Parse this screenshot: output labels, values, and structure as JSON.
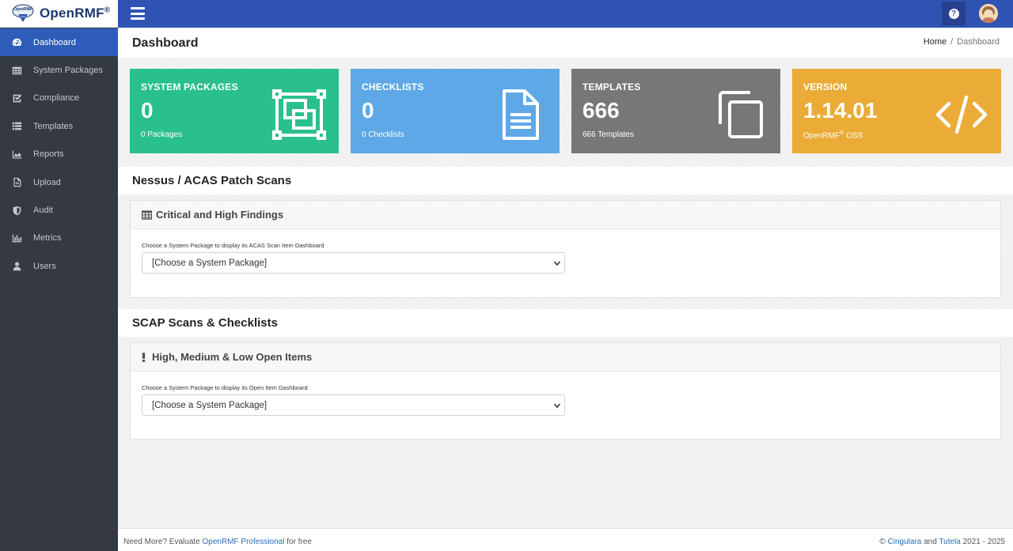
{
  "brand": {
    "name": "OpenRMF",
    "reg": "®"
  },
  "sidebar": {
    "items": [
      {
        "label": "Dashboard",
        "icon": "tachometer-icon",
        "active": true
      },
      {
        "label": "System Packages",
        "icon": "table-icon"
      },
      {
        "label": "Compliance",
        "icon": "check-square-icon"
      },
      {
        "label": "Templates",
        "icon": "list-icon"
      },
      {
        "label": "Reports",
        "icon": "area-chart-icon"
      },
      {
        "label": "Upload",
        "icon": "file-icon"
      },
      {
        "label": "Audit",
        "icon": "shield-icon"
      },
      {
        "label": "Metrics",
        "icon": "bar-chart-icon"
      },
      {
        "label": "Users",
        "icon": "user-icon"
      }
    ]
  },
  "topbar": {
    "help": "?"
  },
  "header": {
    "title": "Dashboard",
    "breadcrumb_home": "Home",
    "breadcrumb_sep": "/",
    "breadcrumb_current": "Dashboard"
  },
  "boxes": [
    {
      "title": "SYSTEM PACKAGES",
      "value": "0",
      "sub": "0 Packages",
      "color": "#29c08b",
      "icon": "object-group-icon"
    },
    {
      "title": "CHECKLISTS",
      "value": "0",
      "sub": "0 Checklists",
      "color": "#5ea8e8",
      "icon": "file-text-icon"
    },
    {
      "title": "TEMPLATES",
      "value": "666",
      "sub": "666 Templates",
      "color": "#777777",
      "icon": "copy-icon"
    },
    {
      "title": "VERSION",
      "value": "1.14.01",
      "sub_prefix": "OpenRMF",
      "sub_reg": "®",
      "sub_suffix": " OSS",
      "color": "#ebab37",
      "icon": "code-icon"
    }
  ],
  "sections": {
    "nessus": {
      "title": "Nessus / ACAS Patch Scans",
      "card_title": "Critical and High Findings",
      "card_icon": "table-icon",
      "select_label": "Choose a System Package to display its ACAS Scan Item Dashboard",
      "select_value": "[Choose a System Package]"
    },
    "scap": {
      "title": "SCAP Scans & Checklists",
      "card_title": "High, Medium & Low Open Items",
      "card_icon": "exclamation-icon",
      "select_label": "Choose a System Package to display its Open Item Dashboard",
      "select_value": "[Choose a System Package]"
    }
  },
  "footer": {
    "left_prefix": "Need More? Evaluate ",
    "left_link": "OpenRMF Professional",
    "left_suffix": " for free",
    "right_prefix": "© ",
    "right_link1": "Cingulara",
    "right_and": " and ",
    "right_link2": "Tutela",
    "right_suffix": " 2021 - 2025"
  }
}
